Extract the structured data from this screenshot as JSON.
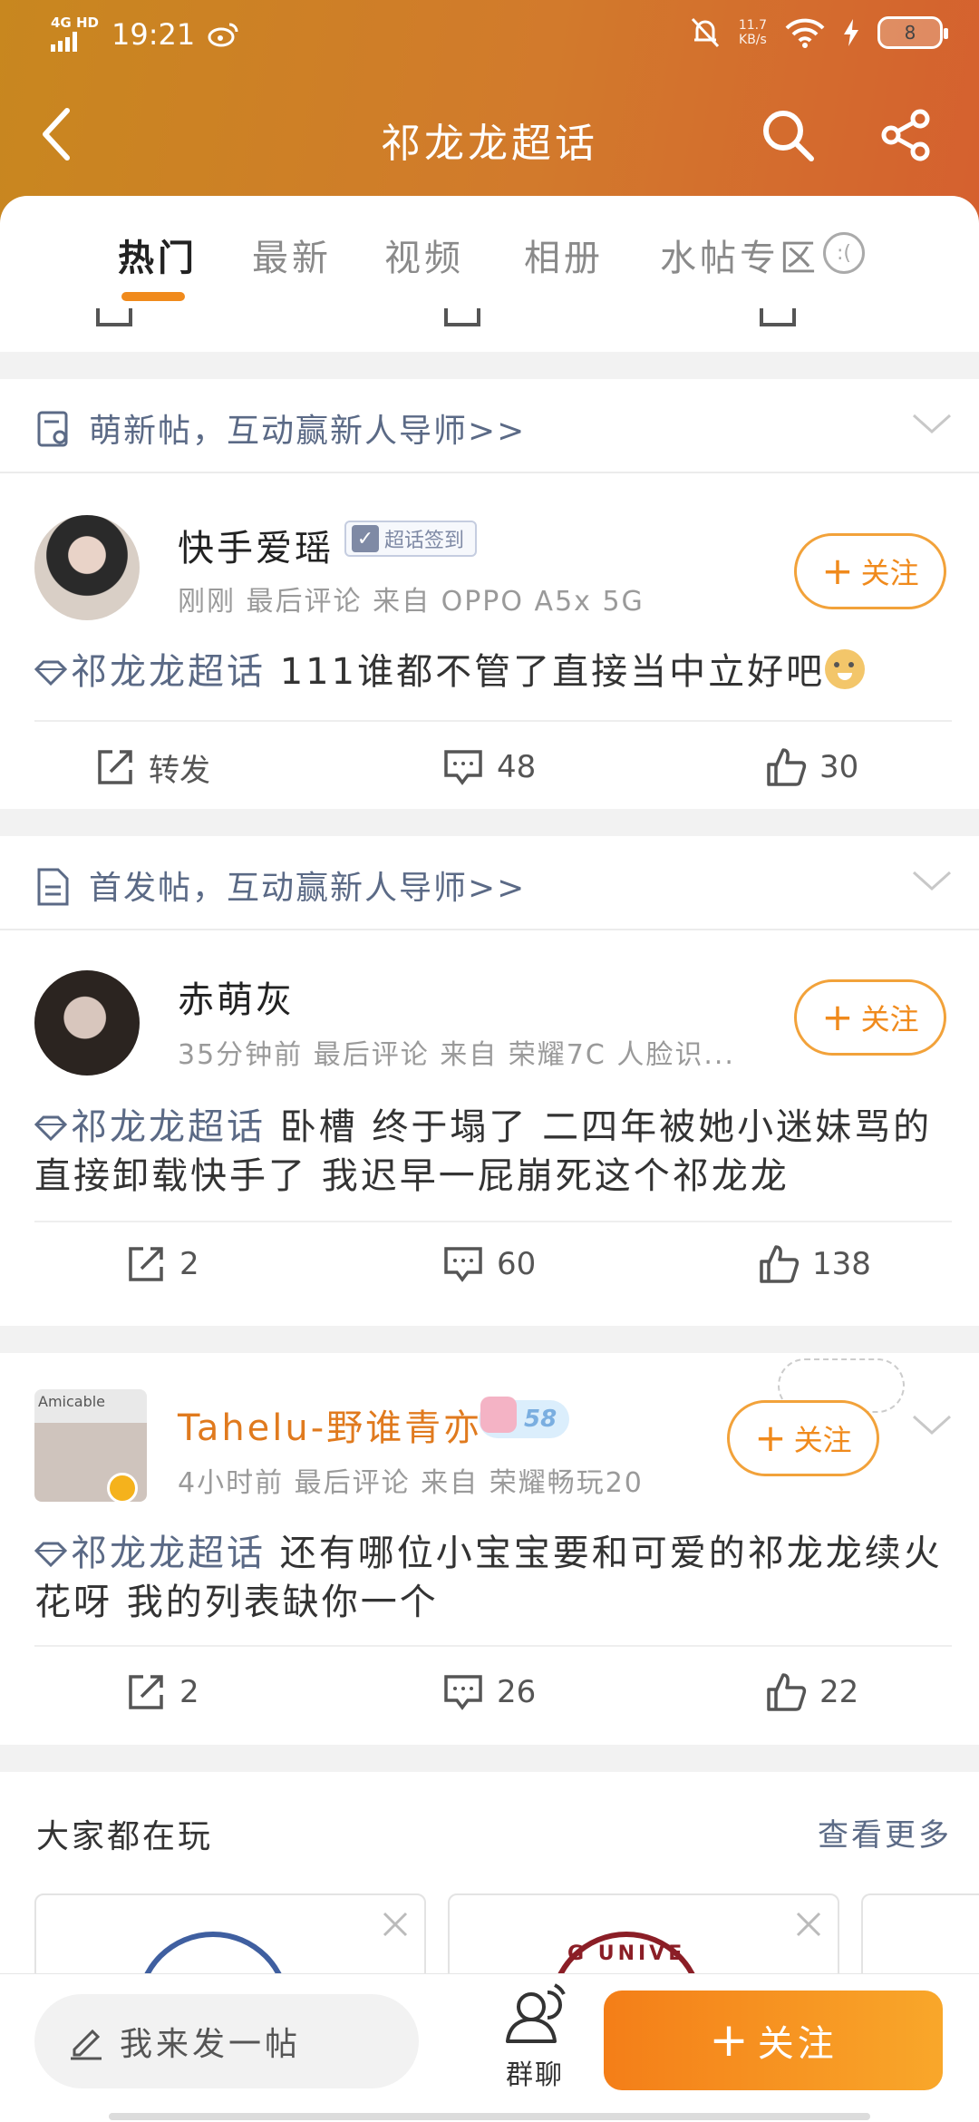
{
  "statusbar": {
    "network": "4G HD",
    "time": "19:21",
    "speed": "11.7",
    "speed_unit": "KB/s",
    "battery": "8"
  },
  "navbar": {
    "title": "祁龙龙超话"
  },
  "tabs": [
    {
      "label": "热门",
      "active": true
    },
    {
      "label": "最新",
      "active": false
    },
    {
      "label": "视频",
      "active": false
    },
    {
      "label": "相册",
      "active": false
    },
    {
      "label": "水帖专区",
      "active": false
    }
  ],
  "posts": [
    {
      "section": "萌新帖，互动赢新人导师>>",
      "user": "快手爱瑶",
      "badge": "超话签到",
      "meta": "刚刚  最后评论   来自 OPPO A5x 5G",
      "topic": "祁龙龙超话",
      "text": "111谁都不管了直接当中立好吧",
      "repost": "转发",
      "comments": "48",
      "likes": "30",
      "follow": "关注"
    },
    {
      "section": "首发帖，互动赢新人导师>>",
      "user": "赤萌灰",
      "meta": "35分钟前  最后评论   来自 荣耀7C 人脸识...",
      "topic": "祁龙龙超话",
      "text": "卧槽 终于塌了 二四年被她小迷妹骂的直接卸载快手了 我迟早一屁崩死这个祁龙龙",
      "reposts": "2",
      "comments": "60",
      "likes": "138",
      "follow": "关注"
    },
    {
      "user": "Tahelu-野谁青亦",
      "level": "58",
      "meta": "4小时前  最后评论   来自 荣耀畅玩20",
      "topic": "祁龙龙超话",
      "text": "还有哪位小宝宝要和可爱的祁龙龙续火花呀 我的列表缺你一个",
      "reposts": "2",
      "comments": "26",
      "likes": "22",
      "follow": "关注",
      "avatar_text": "Amicable"
    }
  ],
  "recommend": {
    "title": "大家都在玩",
    "more": "查看更多",
    "card2_text": "G UNIVE"
  },
  "bottombar": {
    "compose": "我来发一帖",
    "group_chat": "群聊",
    "follow": "关注"
  },
  "colors": {
    "accent": "#f08a1c",
    "header_start": "#c8871f",
    "header_end": "#d5602f",
    "topic": "#5b6a86"
  }
}
